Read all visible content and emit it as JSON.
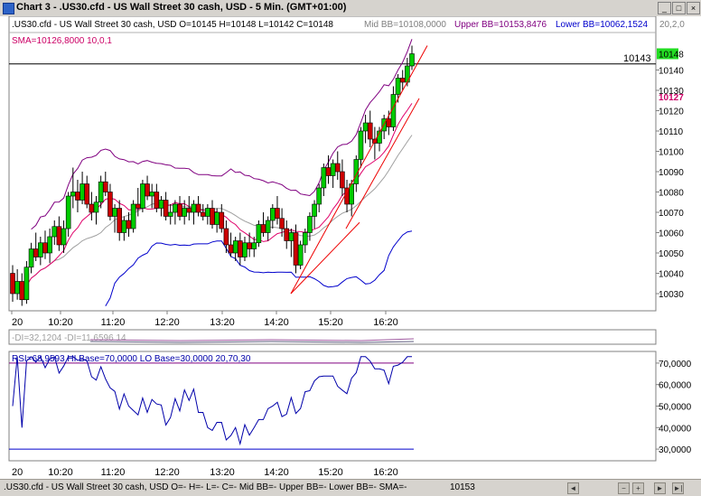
{
  "window": {
    "title": "Chart 3 - .US30.cfd - US Wall Street 30 cash, USD - 5 Min. (GMT+01:00)",
    "icon": "chart-window-icon",
    "minimize": "_",
    "maximize": "□",
    "close": "×"
  },
  "colors": {
    "bull": "#00cc00",
    "bear": "#cc0000",
    "bbUpper": "#800080",
    "bbLower": "#0000cc",
    "sma": "#e0006a",
    "trend": "#ee0000",
    "grey": "#a0a0a0",
    "rsi": "#0000aa"
  },
  "chart_data": [
    {
      "type": "candlestick",
      "title": ".US30.cfd - US Wall Street 30 cash, USD O=10145 H=10148 L=10142 C=10148",
      "indicator_labels": [
        "Mid BB=10108,0000",
        "Upper BB=10153,8476",
        "Lower BB=10062,1524",
        "20,2,0"
      ],
      "sma_label": "SMA=10126,8000  10,0,1",
      "ylim": [
        10022,
        10158
      ],
      "y_ticks": [
        "10030",
        "10040",
        "10050",
        "10060",
        "10070",
        "10080",
        "10090",
        "10100",
        "10110",
        "10120",
        "10130",
        "10140"
      ],
      "x_ticks": [
        "20",
        "10:20",
        "11:20",
        "12:20",
        "13:20",
        "14:20",
        "15:20",
        "16:20"
      ],
      "price_line": 10143,
      "price_line_label": "10143",
      "last_price_label": "10148",
      "sma_value_label": "10127",
      "candles": [
        [
          10040,
          10044,
          10026,
          10030
        ],
        [
          10030,
          10042,
          10027,
          10036
        ],
        [
          10036,
          10040,
          10024,
          10027
        ],
        [
          10027,
          10046,
          10025,
          10043
        ],
        [
          10043,
          10055,
          10040,
          10052
        ],
        [
          10052,
          10060,
          10046,
          10048
        ],
        [
          10048,
          10058,
          10044,
          10055
        ],
        [
          10055,
          10061,
          10047,
          10050
        ],
        [
          10050,
          10062,
          10045,
          10058
        ],
        [
          10058,
          10066,
          10054,
          10063
        ],
        [
          10063,
          10068,
          10051,
          10054
        ],
        [
          10054,
          10066,
          10050,
          10062
        ],
        [
          10062,
          10080,
          10058,
          10078
        ],
        [
          10078,
          10092,
          10072,
          10080
        ],
        [
          10080,
          10086,
          10070,
          10076
        ],
        [
          10076,
          10090,
          10074,
          10084
        ],
        [
          10084,
          10088,
          10072,
          10074
        ],
        [
          10074,
          10080,
          10066,
          10070
        ],
        [
          10070,
          10078,
          10064,
          10075
        ],
        [
          10075,
          10088,
          10072,
          10085
        ],
        [
          10085,
          10090,
          10078,
          10080
        ],
        [
          10080,
          10084,
          10066,
          10068
        ],
        [
          10068,
          10074,
          10060,
          10072
        ],
        [
          10072,
          10076,
          10056,
          10060
        ],
        [
          10060,
          10068,
          10056,
          10066
        ],
        [
          10066,
          10070,
          10058,
          10062
        ],
        [
          10062,
          10076,
          10060,
          10074
        ],
        [
          10074,
          10082,
          10068,
          10072
        ],
        [
          10072,
          10086,
          10070,
          10084
        ],
        [
          10084,
          10088,
          10076,
          10078
        ],
        [
          10078,
          10084,
          10072,
          10080
        ],
        [
          10080,
          10084,
          10070,
          10072
        ],
        [
          10072,
          10078,
          10068,
          10076
        ],
        [
          10076,
          10080,
          10066,
          10068
        ],
        [
          10068,
          10074,
          10064,
          10070
        ],
        [
          10070,
          10076,
          10064,
          10074
        ],
        [
          10074,
          10078,
          10066,
          10068
        ],
        [
          10068,
          10076,
          10064,
          10072
        ],
        [
          10072,
          10078,
          10066,
          10070
        ],
        [
          10070,
          10076,
          10064,
          10074
        ],
        [
          10074,
          10078,
          10068,
          10070
        ],
        [
          10070,
          10074,
          10066,
          10068
        ],
        [
          10068,
          10074,
          10064,
          10072
        ],
        [
          10072,
          10076,
          10062,
          10064
        ],
        [
          10064,
          10072,
          10060,
          10070
        ],
        [
          10070,
          10074,
          10060,
          10062
        ],
        [
          10062,
          10066,
          10050,
          10054
        ],
        [
          10054,
          10060,
          10048,
          10050
        ],
        [
          10050,
          10058,
          10046,
          10056
        ],
        [
          10056,
          10060,
          10044,
          10048
        ],
        [
          10048,
          10058,
          10046,
          10055
        ],
        [
          10055,
          10060,
          10048,
          10052
        ],
        [
          10052,
          10058,
          10048,
          10055
        ],
        [
          10055,
          10066,
          10053,
          10064
        ],
        [
          10064,
          10070,
          10058,
          10060
        ],
        [
          10060,
          10068,
          10056,
          10066
        ],
        [
          10066,
          10074,
          10062,
          10072
        ],
        [
          10072,
          10078,
          10064,
          10067
        ],
        [
          10067,
          10072,
          10058,
          10062
        ],
        [
          10062,
          10066,
          10052,
          10056
        ],
        [
          10056,
          10062,
          10048,
          10060
        ],
        [
          10060,
          10064,
          10040,
          10044
        ],
        [
          10044,
          10056,
          10042,
          10054
        ],
        [
          10054,
          10062,
          10050,
          10060
        ],
        [
          10060,
          10070,
          10056,
          10068
        ],
        [
          10068,
          10076,
          10062,
          10074
        ],
        [
          10074,
          10084,
          10070,
          10082
        ],
        [
          10082,
          10094,
          10078,
          10092
        ],
        [
          10092,
          10098,
          10084,
          10088
        ],
        [
          10088,
          10096,
          10082,
          10094
        ],
        [
          10094,
          10100,
          10086,
          10090
        ],
        [
          10090,
          10096,
          10078,
          10082
        ],
        [
          10082,
          10086,
          10070,
          10074
        ],
        [
          10074,
          10086,
          10068,
          10084
        ],
        [
          10084,
          10098,
          10080,
          10096
        ],
        [
          10096,
          10112,
          10092,
          10110
        ],
        [
          10110,
          10118,
          10104,
          10114
        ],
        [
          10114,
          10120,
          10102,
          10106
        ],
        [
          10106,
          10112,
          10096,
          10104
        ],
        [
          10104,
          10112,
          10100,
          10110
        ],
        [
          10110,
          10118,
          10106,
          10116
        ],
        [
          10116,
          10120,
          10108,
          10112
        ],
        [
          10112,
          10132,
          10110,
          10128
        ],
        [
          10128,
          10138,
          10124,
          10136
        ],
        [
          10136,
          10140,
          10130,
          10134
        ],
        [
          10134,
          10146,
          10132,
          10142
        ],
        [
          10142,
          10152,
          10140,
          10148
        ]
      ]
    },
    {
      "type": "line",
      "title": "-DI=32,1204  -DI=11,6596  14"
    },
    {
      "type": "line",
      "title": "RSI=68,9593 HI Base=70,0000 LO Base=30,0000   20,70,30",
      "ylim": [
        25,
        75
      ],
      "y_ticks": [
        "30,0000",
        "40,0000",
        "50,0000",
        "60,0000",
        "70,0000"
      ],
      "x_ticks": [
        "20",
        "10:20",
        "11:20",
        "12:20",
        "13:20",
        "14:20",
        "15:20",
        "16:20"
      ],
      "hi_base": 70,
      "lo_base": 30
    }
  ],
  "status": {
    "text": ".US30.cfd - US Wall Street 30 cash, USD O=- H=- L=- C=- Mid BB=- Upper BB=- Lower BB=- SMA=-",
    "value": "10153"
  }
}
